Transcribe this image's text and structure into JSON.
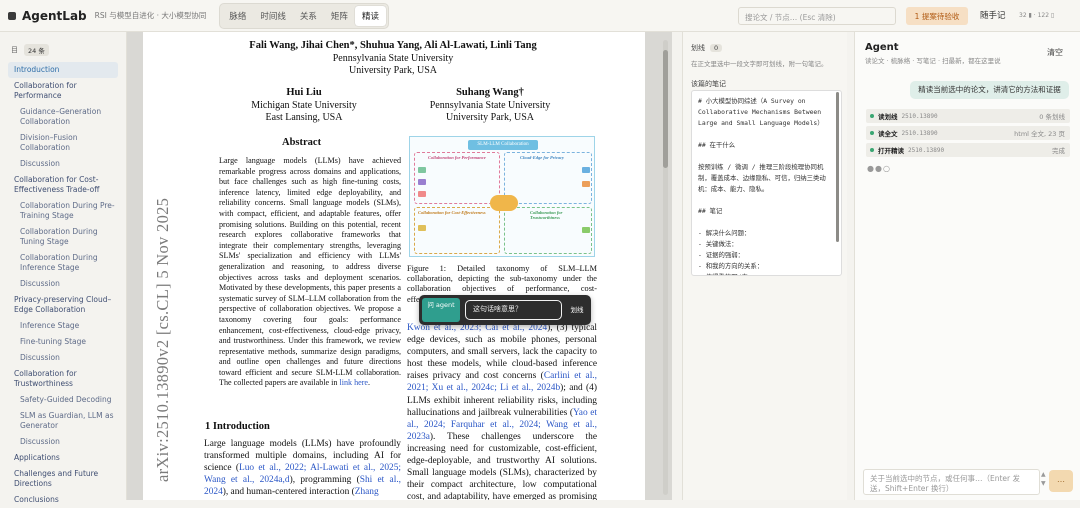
{
  "app": {
    "title": "AgentLab",
    "subtitle": "RSI 与模型自进化 · 大小模型协同"
  },
  "tabs": [
    "脉络",
    "时间线",
    "关系",
    "矩阵",
    "精读"
  ],
  "topbar": {
    "search_placeholder": "搜论文 / 节点… (Esc 清除)",
    "proposal_label": "1 提案待验收",
    "notes_label": "随手记",
    "zoom_text": "32 ▮ · 122 ▯"
  },
  "sidebar": {
    "head_label": "目",
    "count": "24 条",
    "items": [
      {
        "label": "Introduction",
        "level": 0,
        "active": true
      },
      {
        "label": "Collaboration for Performance",
        "level": 0
      },
      {
        "label": "Guidance–Generation Collaboration",
        "level": 1
      },
      {
        "label": "Division–Fusion Collaboration",
        "level": 1
      },
      {
        "label": "Discussion",
        "level": 1
      },
      {
        "label": "Collaboration for Cost-Effectiveness Trade-off",
        "level": 0
      },
      {
        "label": "Collaboration During Pre-Training Stage",
        "level": 1
      },
      {
        "label": "Collaboration During Tuning Stage",
        "level": 1
      },
      {
        "label": "Collaboration During Inference Stage",
        "level": 1
      },
      {
        "label": "Discussion",
        "level": 1
      },
      {
        "label": "Privacy-preserving Cloud–Edge Collaboration",
        "level": 0
      },
      {
        "label": "Inference Stage",
        "level": 1
      },
      {
        "label": "Fine-tuning Stage",
        "level": 1
      },
      {
        "label": "Discussion",
        "level": 1
      },
      {
        "label": "Collaboration for Trustworthiness",
        "level": 0
      },
      {
        "label": "Safety-Guided Decoding",
        "level": 1
      },
      {
        "label": "SLM as Guardian, LLM as Generator",
        "level": 1
      },
      {
        "label": "Discussion",
        "level": 1
      },
      {
        "label": "Applications",
        "level": 0
      },
      {
        "label": "Challenges and Future Directions",
        "level": 0
      },
      {
        "label": "Conclusions",
        "level": 0
      }
    ]
  },
  "pdf": {
    "authors_line": "Fali Wang, Jihai Chen*, Shuhua Yang, Ali Al-Lawati, Linli Tang",
    "affil_main_1": "Pennsylvania State University",
    "affil_main_2": "University Park, USA",
    "author_left_name": "Hui Liu",
    "author_left_aff1": "Michigan State University",
    "author_left_aff2": "East Lansing, USA",
    "author_right_name": "Suhang Wang†",
    "author_right_aff1": "Pennsylvania State University",
    "author_right_aff2": "University Park, USA",
    "arxiv_id": "arXiv:2510.13890v2  [cs.CL]  5 Nov 2025",
    "abstract_title": "Abstract",
    "abstract_text": "Large language models (LLMs) have achieved remarkable progress across domains and applications, but face challenges such as high fine-tuning costs, inference latency, limited edge deployability, and reliability concerns. Small language models (SLMs), with compact, efficient, and adaptable features, offer promising solutions. Building on this potential, recent research explores collaborative frameworks that integrate their complementary strengths, leveraging SLMs' specialization and efficiency with LLMs' generalization and reasoning, to address diverse objectives across tasks and deployment scenarios. Motivated by these developments, this paper presents a systematic survey of SLM–LLM collaboration from the perspective of collaboration objectives. We propose a taxonomy covering four goals: performance enhancement, cost-effectiveness, cloud-edge privacy, and trustworthiness. Under this framework, we review representative methods, summarize design paradigms, and outline open challenges and future directions toward efficient and secure SLM-LLM collaboration. The collected papers are available in",
    "abstract_link": "link here",
    "section_title": "1    Introduction",
    "intro_text": "Large language models (LLMs) have profoundly transformed multiple domains, including AI for science (",
    "intro_cites_1": "Luo et al., 2022; Al-Lawati et al., 2025; Wang et al., 2024a,d",
    "intro_text_2": "), programming (",
    "intro_cites_2": "Shi et al., 2024",
    "intro_text_3": "), and human-centered interaction (",
    "intro_cites_3": "Zhang",
    "figure_caption": "Figure 1: Detailed taxonomy of SLM–LLM collaboration, depicting the sub-taxonomy under the collaboration objectives of performance, cost-effectiveness, privacy...",
    "right_col_cite_0": "Kwon et al., 2023; Cai et al., 2024",
    "right_col_text": "), (3) typical edge devices, such as mobile phones, personal computers, and small servers, lack the capacity to host these models, while cloud-based inference raises privacy and cost concerns (",
    "right_col_cite_1": "Carlini et al., 2021; Xu et al., 2024c; Li et al., 2024b",
    "right_col_text_2": "); and (4) LLMs exhibit inherent reliability risks, including hallucinations and jailbreak vulnerabilities (",
    "right_col_cite_2": "Yao et al., 2024; Farquhar et al., 2024; Wang et al., 2023a",
    "right_col_text_3": "). These challenges underscore the increasing need for customizable, cost-efficient, edge-deployable, and trustworthy AI solutions. Small language models (SLMs), characterized by their compact architecture, low computational cost, and adaptability, have emerged as promising counterparts to miti-",
    "figure": {
      "title": "SLM-LLM Collaboration",
      "labels": [
        "Collaboration for Performance",
        "Cloud-Edge for Privacy",
        "Collaboration for Cost-Effectiveness",
        "Collaboration for Trustworthiness"
      ]
    }
  },
  "float_bar": {
    "ask_label": "问 agent",
    "input_value": "这句话啥意思？",
    "draw_label": "划线"
  },
  "notes_panel": {
    "header": "划线",
    "count": "0",
    "hint": "在正文里选中一段文字即可划线，附一句笔记。",
    "section_label": "该篇的笔记",
    "content": "# 小大模型协同综述（A Survey on Collaborative Mechanisms Between Large and Small Language Models）\n\n## 在干什么\n\n按预训练 / 微调 / 推理三阶段梳理协同机制，覆盖成本、边缘隐私、可信，归纳三类动机：成本、能力、隐私。\n\n## 笔记\n\n- 解决什么问题：\n- 关键做法：\n- 证据的强弱：\n- 和我的方向的关系：\n- 值得看的图/表："
  },
  "agent": {
    "title": "Agent",
    "subtitle": "读论文 · 梳脉络 · 写笔记 · 扫最新，都在这里说",
    "clear_label": "清空",
    "user_message": "精读当前选中的论文，讲清它的方法和证据",
    "tools": [
      {
        "name": "读划线",
        "arg": "2510.13890",
        "result": "0 条划线"
      },
      {
        "name": "读全文",
        "arg": "2510.13890",
        "result": "html 全文, 23 页"
      },
      {
        "name": "打开精读",
        "arg": "2510.13890",
        "result": "完成"
      }
    ],
    "typing": "●●○",
    "input_placeholder": "关于当前选中的节点，或任何事…（Enter 发送，Shift+Enter 换行）",
    "send_label": "…",
    "colors": {
      "user_bubble": "#dfeee9",
      "tool_ok": "#3aa672",
      "send": "#f3d9b0"
    }
  }
}
